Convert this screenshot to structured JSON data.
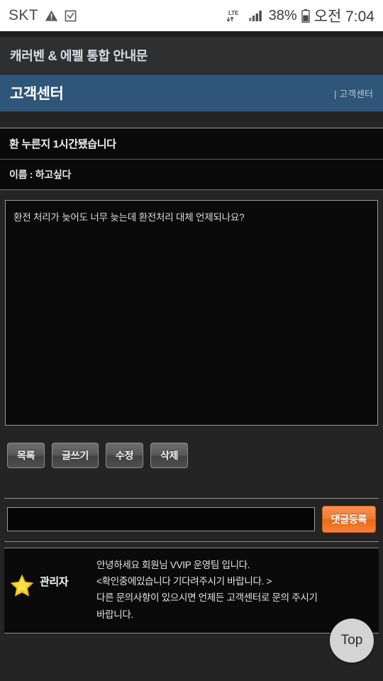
{
  "statusbar": {
    "carrier": "SKT",
    "warning_icon": "warning-triangle-icon",
    "checkbox_icon": "checkbox-icon",
    "network": "LTE",
    "signal_icon": "signal-bars-icon",
    "battery_percent": "38%",
    "battery_icon": "battery-icon",
    "time": "오전 7:04"
  },
  "sitebar": {
    "title": "캐러벤 & 에펠 통합 안내문"
  },
  "pagehead": {
    "title": "고객센터",
    "breadcrumb": "| 고객센터",
    "accent_color": "#2f5578"
  },
  "article": {
    "title": "환 누른지 1시간됐습니다",
    "author_line": "이름 : 하고싶다",
    "body": "환전 처리가 늦어도 너무 늦는데 환전처리 대체 언제되나요?"
  },
  "buttons": [
    {
      "label": "목록",
      "name": "list-button"
    },
    {
      "label": "글쓰기",
      "name": "write-button"
    },
    {
      "label": "수정",
      "name": "edit-button"
    },
    {
      "label": "삭제",
      "name": "delete-button"
    }
  ],
  "comment_form": {
    "value": "",
    "placeholder": "",
    "submit_label": "댓글등록",
    "submit_color": "#f07a2e"
  },
  "comments": [
    {
      "author": "관리자",
      "badge_icon": "star-icon",
      "line1": "안녕하세요 회원님 VVIP 운영팀 입니다.",
      "line2": "<확인중에있습니다 기다려주시기 바랍니다. >",
      "line3": "다른 문의사항이 있으시면 언제든 고객센터로 문의 주시기",
      "line4": "바랍니다."
    }
  ],
  "fab": {
    "label": "Top"
  }
}
